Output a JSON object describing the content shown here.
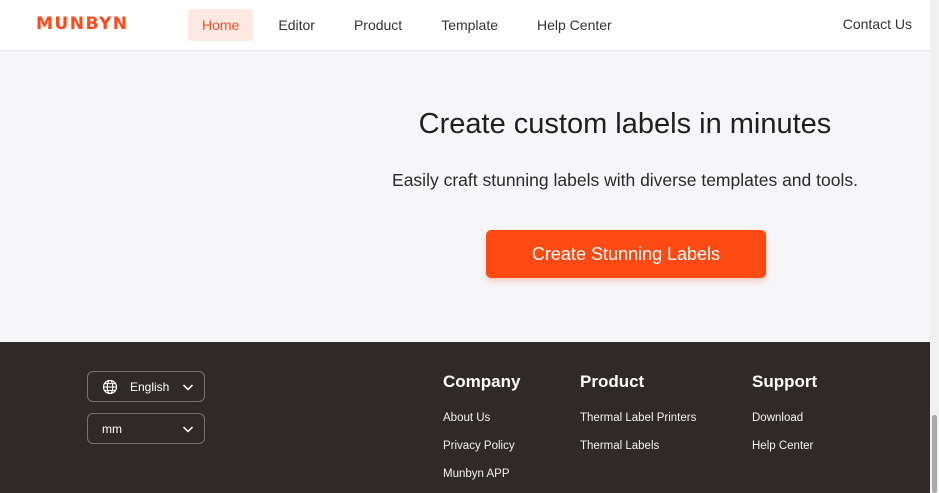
{
  "header": {
    "logo": "MUNBYN",
    "nav": [
      {
        "label": "Home",
        "active": true
      },
      {
        "label": "Editor",
        "active": false
      },
      {
        "label": "Product",
        "active": false
      },
      {
        "label": "Template",
        "active": false
      },
      {
        "label": "Help Center",
        "active": false
      }
    ],
    "contact": "Contact Us"
  },
  "hero": {
    "title": "Create custom labels in minutes",
    "subtitle": "Easily craft stunning labels with diverse templates and tools.",
    "cta": "Create Stunning Labels"
  },
  "footer": {
    "language": "English",
    "unit": "mm",
    "columns": [
      {
        "title": "Company",
        "links": [
          "About Us",
          "Privacy Policy",
          "Munbyn APP"
        ]
      },
      {
        "title": "Product",
        "links": [
          "Thermal Label Printers",
          "Thermal Labels"
        ]
      },
      {
        "title": "Support",
        "links": [
          "Download",
          "Help Center"
        ]
      }
    ]
  },
  "colors": {
    "accent": "#ff4a14",
    "nav_active_bg": "#fde8e2",
    "footer_bg": "#2f2a28",
    "hero_bg": "#f6f5f8"
  }
}
